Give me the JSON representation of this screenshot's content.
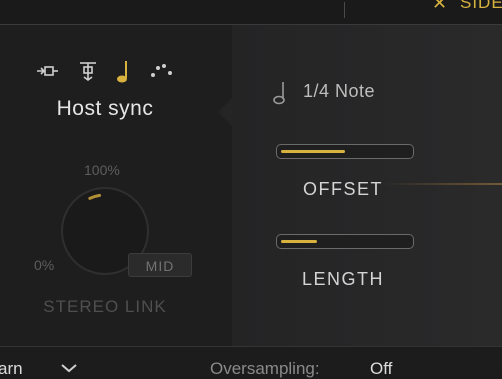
{
  "topbar": {
    "side_label": "SIDE"
  },
  "sync_modes": [
    {
      "icon": "free-mode-icon",
      "active": false
    },
    {
      "icon": "tempo-mode-icon",
      "active": false
    },
    {
      "icon": "note-icon",
      "active": true
    },
    {
      "icon": "dotted-note-icon",
      "active": false
    }
  ],
  "sync": {
    "label": "Host sync"
  },
  "stereo_link": {
    "label": "STEREO LINK",
    "max_label": "100%",
    "min_label": "0%",
    "mid_button": "MID",
    "value_fraction": 0.15
  },
  "note": {
    "value": "1/4 Note"
  },
  "offset": {
    "label": "OFFSET",
    "fraction": 0.5
  },
  "length": {
    "label": "LENGTH",
    "fraction": 0.28
  },
  "bottombar": {
    "mode_text": "arn",
    "oversampling_label": "Oversampling:",
    "oversampling_value": "Off"
  },
  "colors": {
    "accent": "#d8b23f",
    "panel": "#1e1e1f",
    "right_panel": "#262627"
  }
}
